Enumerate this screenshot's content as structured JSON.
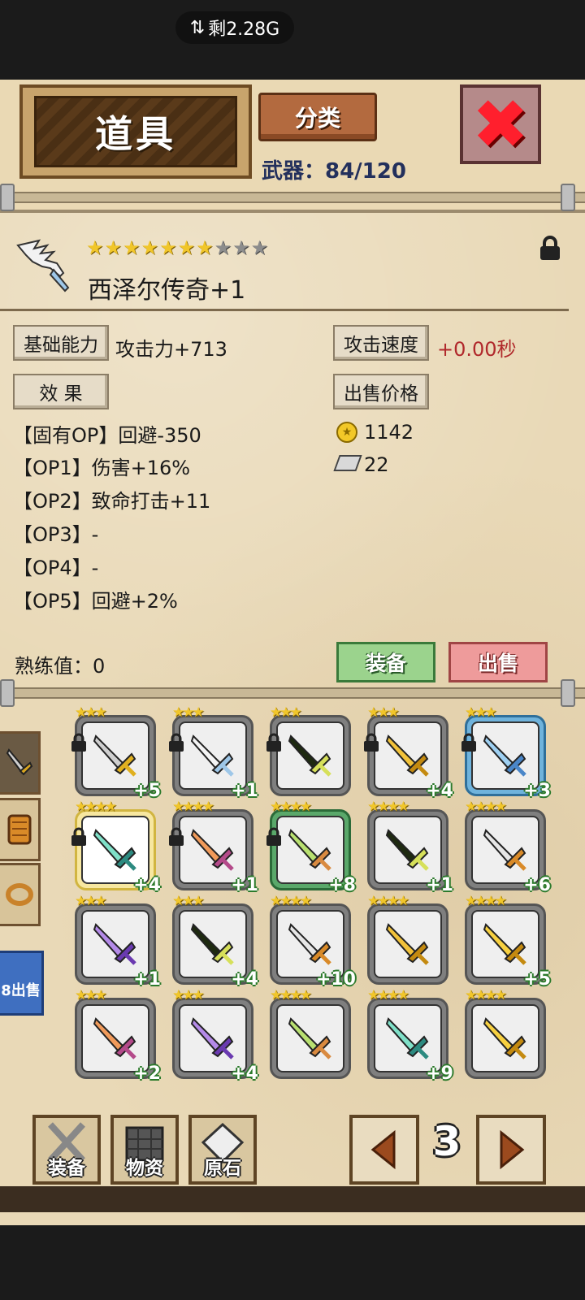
{
  "status_bar": {
    "text": "剩2.28G"
  },
  "header": {
    "title": "道具",
    "category_button": "分类",
    "weapon_count": "武器：84/120"
  },
  "item": {
    "name": "西泽尔传奇+1",
    "stars_filled": 7,
    "stars_total": 10,
    "locked": true
  },
  "stats": {
    "base_label": "基础能力",
    "base_value": "攻击力+713",
    "speed_label": "攻击速度",
    "speed_value": "+0.00秒",
    "effect_label": "效 果",
    "price_label": "出售价格",
    "price_gold": "1142",
    "price_silver": "22"
  },
  "options": [
    "【固有OP】回避-350",
    "【OP1】伤害+16%",
    "【OP2】致命打击+11",
    "【OP3】-",
    "【OP4】-",
    "【OP5】回避+2%"
  ],
  "proficiency": "熟练值：0",
  "actions": {
    "equip": "装备",
    "sell": "出售"
  },
  "side_tabs": {
    "bulk_sell": "8出售"
  },
  "grid": [
    {
      "stars": "★★★",
      "level": "+5",
      "locked": true,
      "frame": "gray",
      "icon": "golden-hilt-sword-icon"
    },
    {
      "stars": "★★★",
      "level": "+1",
      "locked": true,
      "frame": "gray",
      "icon": "winged-sword-icon"
    },
    {
      "stars": "★★★",
      "level": "",
      "locked": true,
      "frame": "gray",
      "icon": "dark-great-sword-icon"
    },
    {
      "stars": "★★★",
      "level": "+4",
      "locked": true,
      "frame": "gray",
      "icon": "golden-spike-sword-icon"
    },
    {
      "stars": "★★★",
      "level": "+3",
      "locked": true,
      "frame": "blue",
      "icon": "crystal-sword-icon"
    },
    {
      "stars": "★★★★",
      "level": "+4",
      "locked": true,
      "frame": "selected",
      "icon": "teal-sword-icon"
    },
    {
      "stars": "★★★★",
      "level": "+1",
      "locked": true,
      "frame": "gray",
      "icon": "orange-sword-icon"
    },
    {
      "stars": "★★★★",
      "level": "+8",
      "locked": true,
      "frame": "green",
      "icon": "green-sword-icon"
    },
    {
      "stars": "★★★★",
      "level": "+1",
      "locked": false,
      "frame": "gray",
      "icon": "dark-great-sword-icon"
    },
    {
      "stars": "★★★★",
      "level": "+6",
      "locked": false,
      "frame": "gray",
      "icon": "knife-icon"
    },
    {
      "stars": "★★★",
      "level": "+1",
      "locked": false,
      "frame": "gray",
      "icon": "purple-sword-icon"
    },
    {
      "stars": "★★★",
      "level": "+4",
      "locked": false,
      "frame": "gray",
      "icon": "dark-great-sword-icon"
    },
    {
      "stars": "★★★★",
      "level": "+10",
      "locked": false,
      "frame": "gray",
      "icon": "knife-icon"
    },
    {
      "stars": "★★★★",
      "level": "",
      "locked": false,
      "frame": "gray",
      "icon": "golden-spike-sword-icon"
    },
    {
      "stars": "★★★★",
      "level": "+5",
      "locked": false,
      "frame": "gray",
      "icon": "golden-saw-sword-icon"
    },
    {
      "stars": "★★★",
      "level": "+2",
      "locked": false,
      "frame": "gray",
      "icon": "orange-sword-icon"
    },
    {
      "stars": "★★★",
      "level": "+4",
      "locked": false,
      "frame": "gray",
      "icon": "purple-sword-icon"
    },
    {
      "stars": "★★★★",
      "level": "",
      "locked": false,
      "frame": "gray",
      "icon": "green-sword-icon"
    },
    {
      "stars": "★★★★",
      "level": "+9",
      "locked": false,
      "frame": "gray",
      "icon": "teal-sword-icon"
    },
    {
      "stars": "★★★★",
      "level": "",
      "locked": false,
      "frame": "gray",
      "icon": "golden-saw-sword-icon"
    }
  ],
  "bottom_nav": {
    "equip": "装备",
    "materials": "物资",
    "ore": "原石",
    "page": "3"
  },
  "colors": {
    "parchment": "#e9d9b7",
    "title_wood": "#4a2f14",
    "close_red": "#ff1f2d",
    "level_green": "#2c7a2c",
    "speed_red": "#b0282b"
  }
}
